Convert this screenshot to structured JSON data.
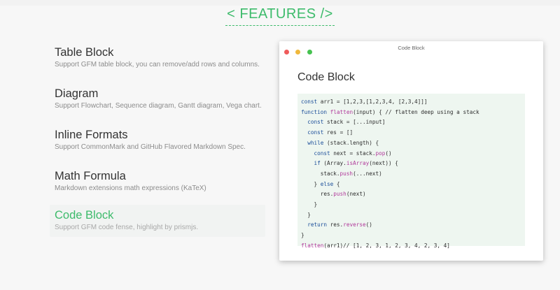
{
  "header": {
    "title": "< FEATURES />"
  },
  "features": [
    {
      "title": "Table Block",
      "desc": "Support GFM table block, you can remove/add rows and columns."
    },
    {
      "title": "Diagram",
      "desc": "Support Flowchart, Sequence diagram, Gantt diagram, Vega chart."
    },
    {
      "title": "Inline Formats",
      "desc": "Support CommonMark and GitHub Flavored Markdown Spec."
    },
    {
      "title": "Math Formula",
      "desc": "Markdown extensions math expressions (KaTeX)"
    },
    {
      "title": "Code Block",
      "desc": "Support GFM code fense, highlight by prismjs.",
      "active": true
    }
  ],
  "window": {
    "title": "Code Block",
    "doc_title": "Code Block",
    "code_lines": [
      "const arr1 = [1,2,3,[1,2,3,4, [2,3,4]]]",
      "function flatten(input) { // flatten deep using a stack",
      "  const stack = [...input]",
      "  const res = []",
      "  while (stack.length) {",
      "    const next = stack.pop()",
      "    if (Array.isArray(next)) {",
      "      stack.push(...next)",
      "    } else {",
      "      res.push(next)",
      "    }",
      "  }",
      "  return res.reverse()",
      "}",
      "flatten(arr1)// [1, 2, 3, 1, 2, 3, 4, 2, 3, 4]"
    ]
  },
  "colors": {
    "accent": "#3dbb6b",
    "code_bg": "#eef6f0",
    "keyword": "#1a4d99",
    "function": "#b0389a"
  }
}
